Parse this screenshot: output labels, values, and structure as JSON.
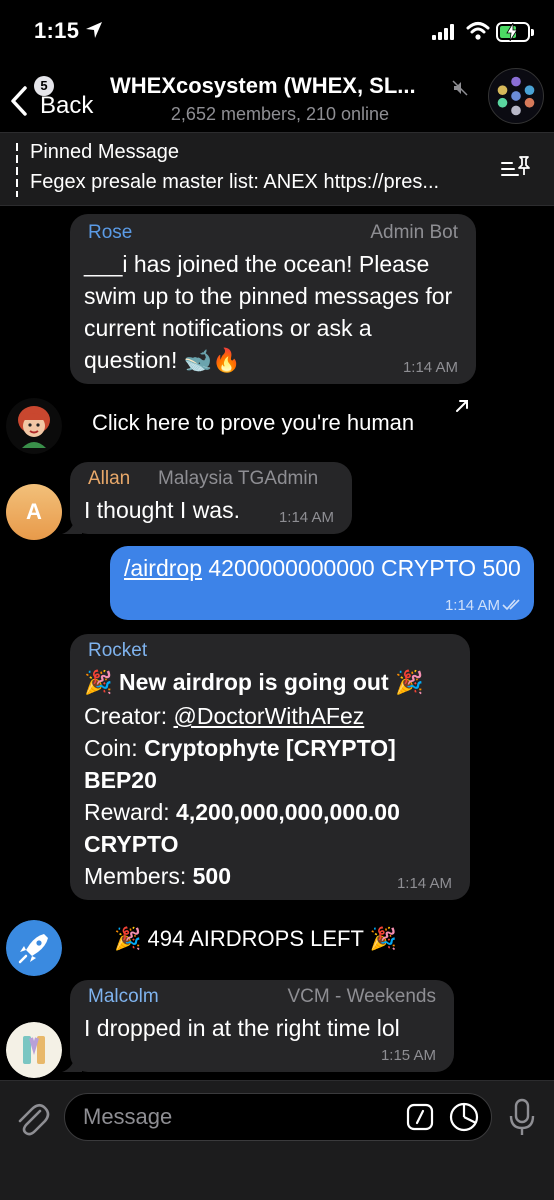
{
  "status_bar": {
    "time": "1:15",
    "battery_charging": true
  },
  "header": {
    "back_badge": "5",
    "back_label": "Back",
    "title": "WHEXcosystem (WHEX, SL...",
    "subtitle": "2,652 members, 210 online"
  },
  "pinned": {
    "title": "Pinned Message",
    "text": "Fegex presale master list: ANEX https://pres..."
  },
  "messages": [
    {
      "sender": "Rose",
      "sender_color": "#5b9be6",
      "role": "Admin Bot",
      "text": "___i has joined the ocean! Please swim up to the pinned messages for current notifications or ask a question! 🐋🔥",
      "time": "1:14 AM"
    },
    {
      "service": "Click here to prove you're human"
    },
    {
      "sender": "Allan",
      "sender_color": "#e8a86a",
      "role": "Malaysia TGAdmin",
      "avatar_letter": "A",
      "text": "I thought I was.",
      "time": "1:14 AM"
    },
    {
      "outgoing": true,
      "command": "/airdrop",
      "text": " 4200000000000 CRYPTO 500",
      "time": "1:14 AM"
    },
    {
      "sender": "Rocket",
      "sender_color": "#7fb3ee",
      "headline": "🎉 New airdrop is going out 🎉",
      "creator_label": "Creator: ",
      "creator_value": "@DoctorWithAFez",
      "coin_label": "Coin: ",
      "coin_value": "Cryptophyte [CRYPTO] BEP20",
      "reward_label": "Reward: ",
      "reward_value": "4,200,000,000,000.00 CRYPTO",
      "members_label": "Members: ",
      "members_value": "500",
      "time": "1:14 AM"
    },
    {
      "service": "🎉 494 AIRDROPS LEFT 🎉"
    },
    {
      "sender": "Malcolm",
      "sender_color": "#7fb3ee",
      "role": "VCM - Weekends",
      "text": "I dropped in at the right time lol",
      "time": "1:15 AM"
    }
  ],
  "input": {
    "placeholder": "Message"
  },
  "colors": {
    "outgoing_bubble": "#3d83e8",
    "incoming_bubble": "#262628",
    "background": "#000000"
  }
}
